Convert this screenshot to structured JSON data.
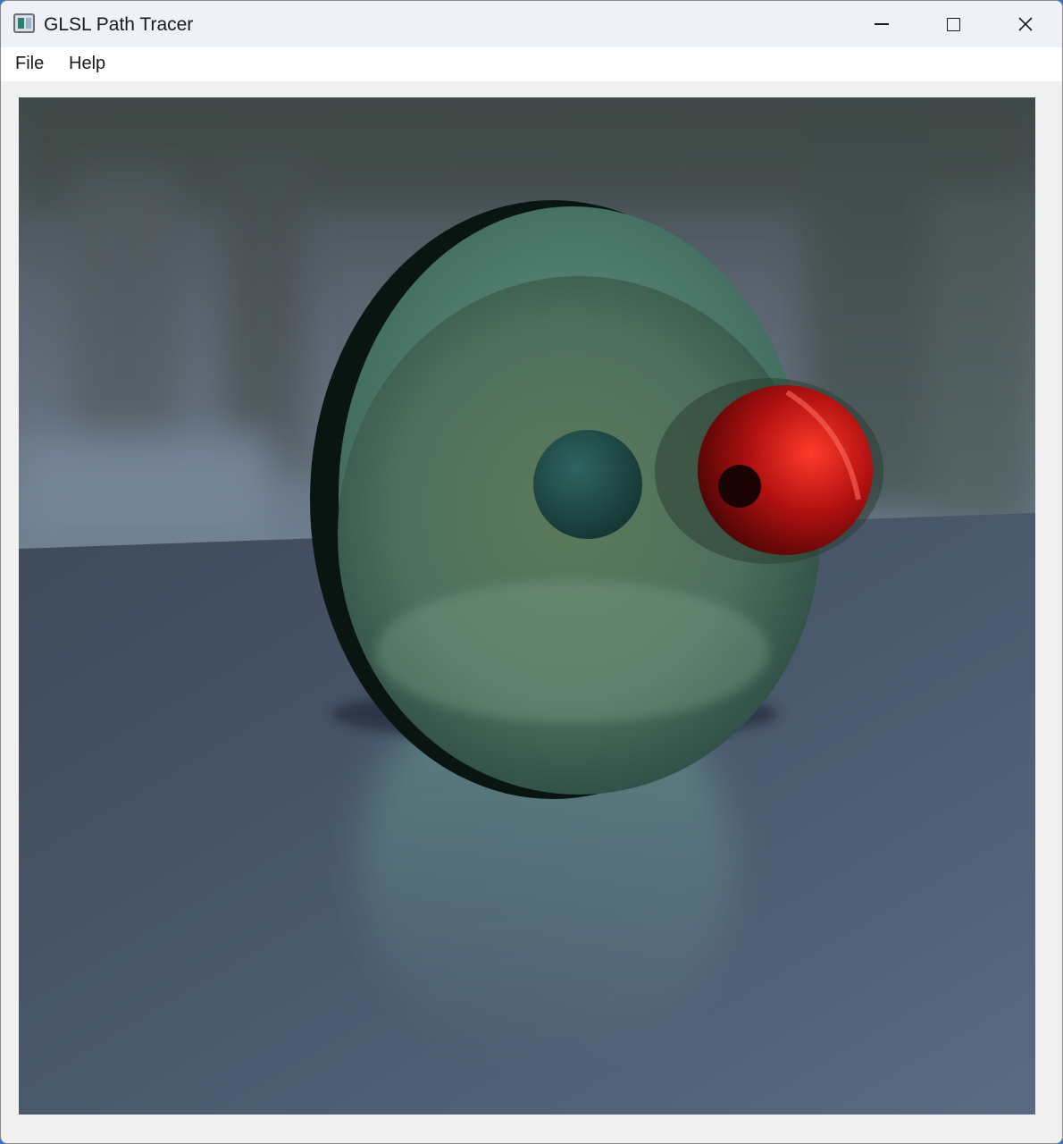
{
  "window": {
    "title": "GLSL Path Tracer",
    "icon": "app-window-icon"
  },
  "controls": {
    "minimize_icon": "minimize-icon",
    "maximize_icon": "maximize-icon",
    "close_icon": "close-icon"
  },
  "menu": {
    "items": [
      {
        "label": "File"
      },
      {
        "label": "Help"
      }
    ]
  },
  "render": {
    "content": "path-traced scene: large green glass sphere with a dark teal inner sphere and a red glass sphere, resting on a grey-blue glossy plane with a blurred forest background",
    "colors": {
      "glass_green": "#5f8f78",
      "inner_sphere": "#1f4d4a",
      "red_sphere": "#b01010",
      "floor": "#4e5d73",
      "background": "#5d6876"
    }
  }
}
